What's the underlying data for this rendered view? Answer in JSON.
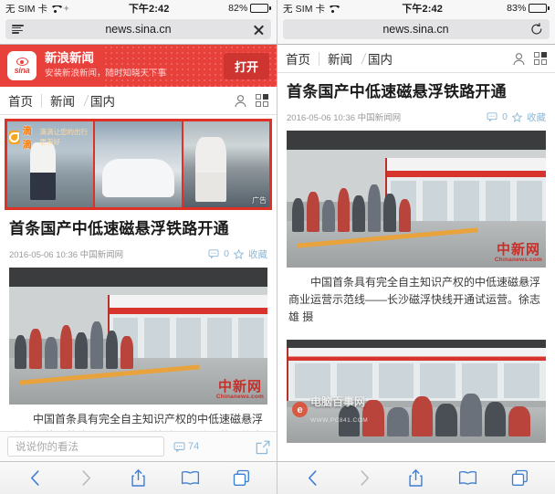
{
  "panels": [
    {
      "id": "left",
      "statusbar": {
        "carrier": "无 SIM 卡",
        "time": "下午2:42",
        "battery": "82%"
      },
      "urlbar": {
        "url": "news.sina.cn",
        "left_icon": "reader-icon",
        "right_icon": "stop-icon"
      },
      "app_banner": {
        "logo_text": "sina",
        "title": "新浪新闻",
        "subtitle": "安装新浪新闻，随时知晓天下事",
        "open_label": "打开"
      },
      "sitenav": {
        "home": "首页",
        "crumb1": "新闻",
        "crumb2": "国内"
      },
      "ad": {
        "sponsor": "滴滴",
        "slogan": "滴滴让您的出行更美好",
        "label": "广告"
      },
      "article": {
        "title": "首条国产中低速磁悬浮铁路开通",
        "date": "2016-05-06 10:36",
        "source": "中国新闻网",
        "comment_count": "0",
        "favorite_label": "收藏",
        "caption": "中国首条具有完全自主知识产权的中低速磁悬浮商业运营示范线——长沙磁浮快线开通试运营。徐志雄 摄",
        "watermark_main": "中新网",
        "watermark_sub": "Chinanews.com"
      },
      "comment_bar": {
        "placeholder": "说说你的看法",
        "count": "74"
      },
      "toolbar": {
        "back": "back-icon",
        "forward": "forward-icon",
        "share": "share-icon",
        "bookmarks": "bookmarks-icon",
        "tabs": "tabs-icon"
      }
    },
    {
      "id": "right",
      "statusbar": {
        "carrier": "无 SIM 卡",
        "time": "下午2:42",
        "battery": "83%"
      },
      "urlbar": {
        "url": "news.sina.cn",
        "right_icon": "refresh-icon"
      },
      "sitenav": {
        "home": "首页",
        "crumb1": "新闻",
        "crumb2": "国内"
      },
      "article": {
        "title": "首条国产中低速磁悬浮铁路开通",
        "date": "2016-05-06 10:36",
        "source": "中国新闻网",
        "comment_count": "0",
        "favorite_label": "收藏",
        "caption": "中国首条具有完全自主知识产权的中低速磁悬浮商业运营示范线——长沙磁浮快线开通试运营。徐志雄 摄",
        "watermark_main": "中新网",
        "watermark_sub": "Chinanews.com",
        "watermark2_main": "电脑百事网",
        "watermark2_sub": "WWW.PC841.COM"
      },
      "toolbar": {
        "back": "back-icon",
        "forward": "forward-icon",
        "share": "share-icon",
        "bookmarks": "bookmarks-icon",
        "tabs": "tabs-icon"
      }
    }
  ],
  "colors": {
    "sina_red": "#e8413c",
    "open_button": "#cf3530",
    "ad_border": "#e03127",
    "safari_blue": "#3b7fd4",
    "link_blue": "#8fb8d6"
  }
}
